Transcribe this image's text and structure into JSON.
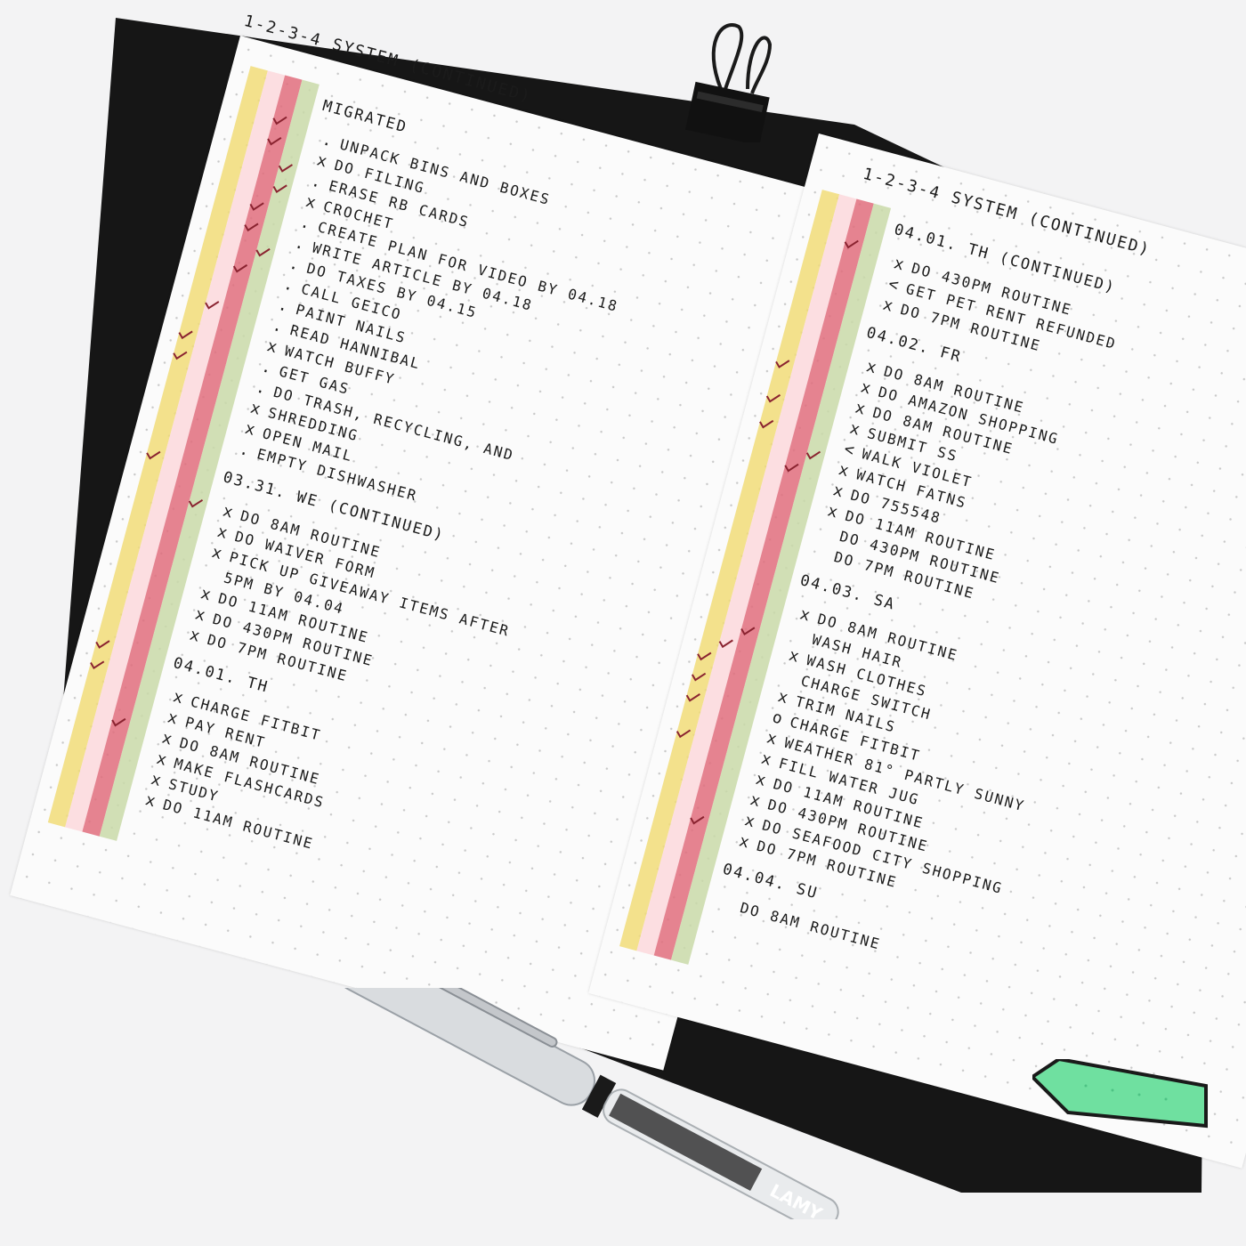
{
  "colors": {
    "yellow": "#f1dc78",
    "pink_light": "#fbd8dc",
    "red": "#e06d7d",
    "green": "#c9d9a8",
    "ink": "#1b1b1b",
    "tab_green": "#6fe0a0"
  },
  "left_page": {
    "title": "1-2-3-4 SYSTEM (CONTINUED)",
    "sections": [
      {
        "header": "MIGRATED",
        "items": [
          {
            "mark": ".",
            "text": "UNPACK BINS AND BOXES"
          },
          {
            "mark": "x",
            "text": "DO FILING"
          },
          {
            "mark": ".",
            "text": "ERASE RB CARDS"
          },
          {
            "mark": "x",
            "text": "CROCHET"
          },
          {
            "mark": ".",
            "text": "CREATE PLAN FOR VIDEO BY 04.18"
          },
          {
            "mark": ".",
            "text": "WRITE ARTICLE BY 04.18"
          },
          {
            "mark": ".",
            "text": "DO TAXES BY 04.15"
          },
          {
            "mark": ".",
            "text": "CALL GEICO"
          },
          {
            "mark": ".",
            "text": "PAINT NAILS"
          },
          {
            "mark": ".",
            "text": "READ HANNIBAL"
          },
          {
            "mark": "x",
            "text": "WATCH BUFFY"
          },
          {
            "mark": ".",
            "text": "GET GAS"
          },
          {
            "mark": ".",
            "text": "DO TRASH, RECYCLING, AND"
          },
          {
            "mark": "x",
            "text": "SHREDDING"
          },
          {
            "mark": "x",
            "text": "OPEN MAIL"
          },
          {
            "mark": ".",
            "text": "EMPTY DISHWASHER"
          }
        ]
      },
      {
        "header": "03.31. WE (CONTINUED)",
        "items": [
          {
            "mark": "x",
            "text": "DO 8AM ROUTINE"
          },
          {
            "mark": "x",
            "text": "DO WAIVER FORM"
          },
          {
            "mark": "x",
            "text": "PICK UP GIVEAWAY ITEMS AFTER"
          },
          {
            "mark": "",
            "text": "5PM BY 04.04"
          },
          {
            "mark": "x",
            "text": "DO 11AM ROUTINE"
          },
          {
            "mark": "x",
            "text": "DO 430PM ROUTINE"
          },
          {
            "mark": "x",
            "text": "DO 7PM ROUTINE"
          }
        ]
      },
      {
        "header": "04.01. TH",
        "items": [
          {
            "mark": "x",
            "text": "CHARGE FITBIT"
          },
          {
            "mark": "x",
            "text": "PAY RENT"
          },
          {
            "mark": "x",
            "text": "DO 8AM ROUTINE"
          },
          {
            "mark": "x",
            "text": "MAKE FLASHCARDS"
          },
          {
            "mark": "x",
            "text": "STUDY"
          },
          {
            "mark": "x",
            "text": "DO 11AM ROUTINE"
          }
        ]
      }
    ]
  },
  "right_page": {
    "title": "1-2-3-4 SYSTEM (CONTINUED)",
    "sections": [
      {
        "header": "04.01. TH (CONTINUED)",
        "items": [
          {
            "mark": "x",
            "text": "DO 430PM ROUTINE"
          },
          {
            "mark": "<",
            "text": "GET PET RENT REFUNDED"
          },
          {
            "mark": "x",
            "text": "DO 7PM ROUTINE"
          }
        ]
      },
      {
        "header": "04.02. FR",
        "items": [
          {
            "mark": "x",
            "text": "DO 8AM ROUTINE"
          },
          {
            "mark": "x",
            "text": "DO AMAZON SHOPPING"
          },
          {
            "mark": "x",
            "text": "DO 8AM ROUTINE"
          },
          {
            "mark": "x",
            "text": "SUBMIT SS"
          },
          {
            "mark": "<",
            "text": "WALK VIOLET"
          },
          {
            "mark": "x",
            "text": "WATCH FATNS"
          },
          {
            "mark": "x",
            "text": "DO 755548"
          },
          {
            "mark": "x",
            "text": "DO 11AM ROUTINE"
          },
          {
            "mark": "",
            "text": "DO 430PM ROUTINE"
          },
          {
            "mark": "",
            "text": "DO 7PM ROUTINE"
          }
        ]
      },
      {
        "header": "04.03. SA",
        "items": [
          {
            "mark": "x",
            "text": "DO 8AM ROUTINE"
          },
          {
            "mark": "",
            "text": "WASH HAIR"
          },
          {
            "mark": "x",
            "text": "WASH CLOTHES"
          },
          {
            "mark": "",
            "text": "CHARGE SWITCH"
          },
          {
            "mark": "x",
            "text": "TRIM NAILS"
          },
          {
            "mark": "o",
            "text": "CHARGE FITBIT"
          },
          {
            "mark": "x",
            "text": "WEATHER 81° PARTLY SUNNY"
          },
          {
            "mark": "x",
            "text": "FILL WATER JUG"
          },
          {
            "mark": "x",
            "text": "DO 11AM ROUTINE"
          },
          {
            "mark": "x",
            "text": "DO 430PM ROUTINE"
          },
          {
            "mark": "x",
            "text": "DO SEAFOOD CITY SHOPPING"
          },
          {
            "mark": "x",
            "text": "DO 7PM ROUTINE"
          }
        ]
      },
      {
        "header": "04.04. SU",
        "items": [
          {
            "mark": "",
            "text": "DO 8AM ROUTINE"
          }
        ]
      }
    ]
  },
  "pen": {
    "brand": "LAMY"
  },
  "binder_clip": {
    "icon": "binder-clip-icon"
  },
  "bookmark_tab": {
    "icon": "tab-flag-icon",
    "color": "#6fe0a0"
  }
}
